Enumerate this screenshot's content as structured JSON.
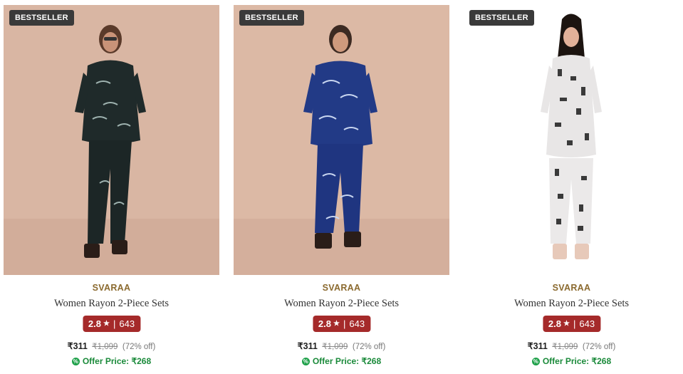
{
  "products": [
    {
      "badge": "BESTSELLER",
      "brand": "SVARAA",
      "title": "Women Rayon 2-Piece Sets",
      "rating": "2.8",
      "rating_count": "643",
      "price": "₹311",
      "mrp": "₹1,099",
      "discount": "(72% off)",
      "offer_price": "Offer Price: ₹268"
    },
    {
      "badge": "BESTSELLER",
      "brand": "SVARAA",
      "title": "Women Rayon 2-Piece Sets",
      "rating": "2.8",
      "rating_count": "643",
      "price": "₹311",
      "mrp": "₹1,099",
      "discount": "(72% off)",
      "offer_price": "Offer Price: ₹268"
    },
    {
      "badge": "BESTSELLER",
      "brand": "SVARAA",
      "title": "Women Rayon 2-Piece Sets",
      "rating": "2.8",
      "rating_count": "643",
      "price": "₹311",
      "mrp": "₹1,099",
      "discount": "(72% off)",
      "offer_price": "Offer Price: ₹268"
    }
  ],
  "colors": {
    "brand_text": "#8b6a2f",
    "rating_bg": "#a52a2a",
    "offer_green": "#1a8a3a",
    "badge_bg": "#3a3a3a"
  }
}
